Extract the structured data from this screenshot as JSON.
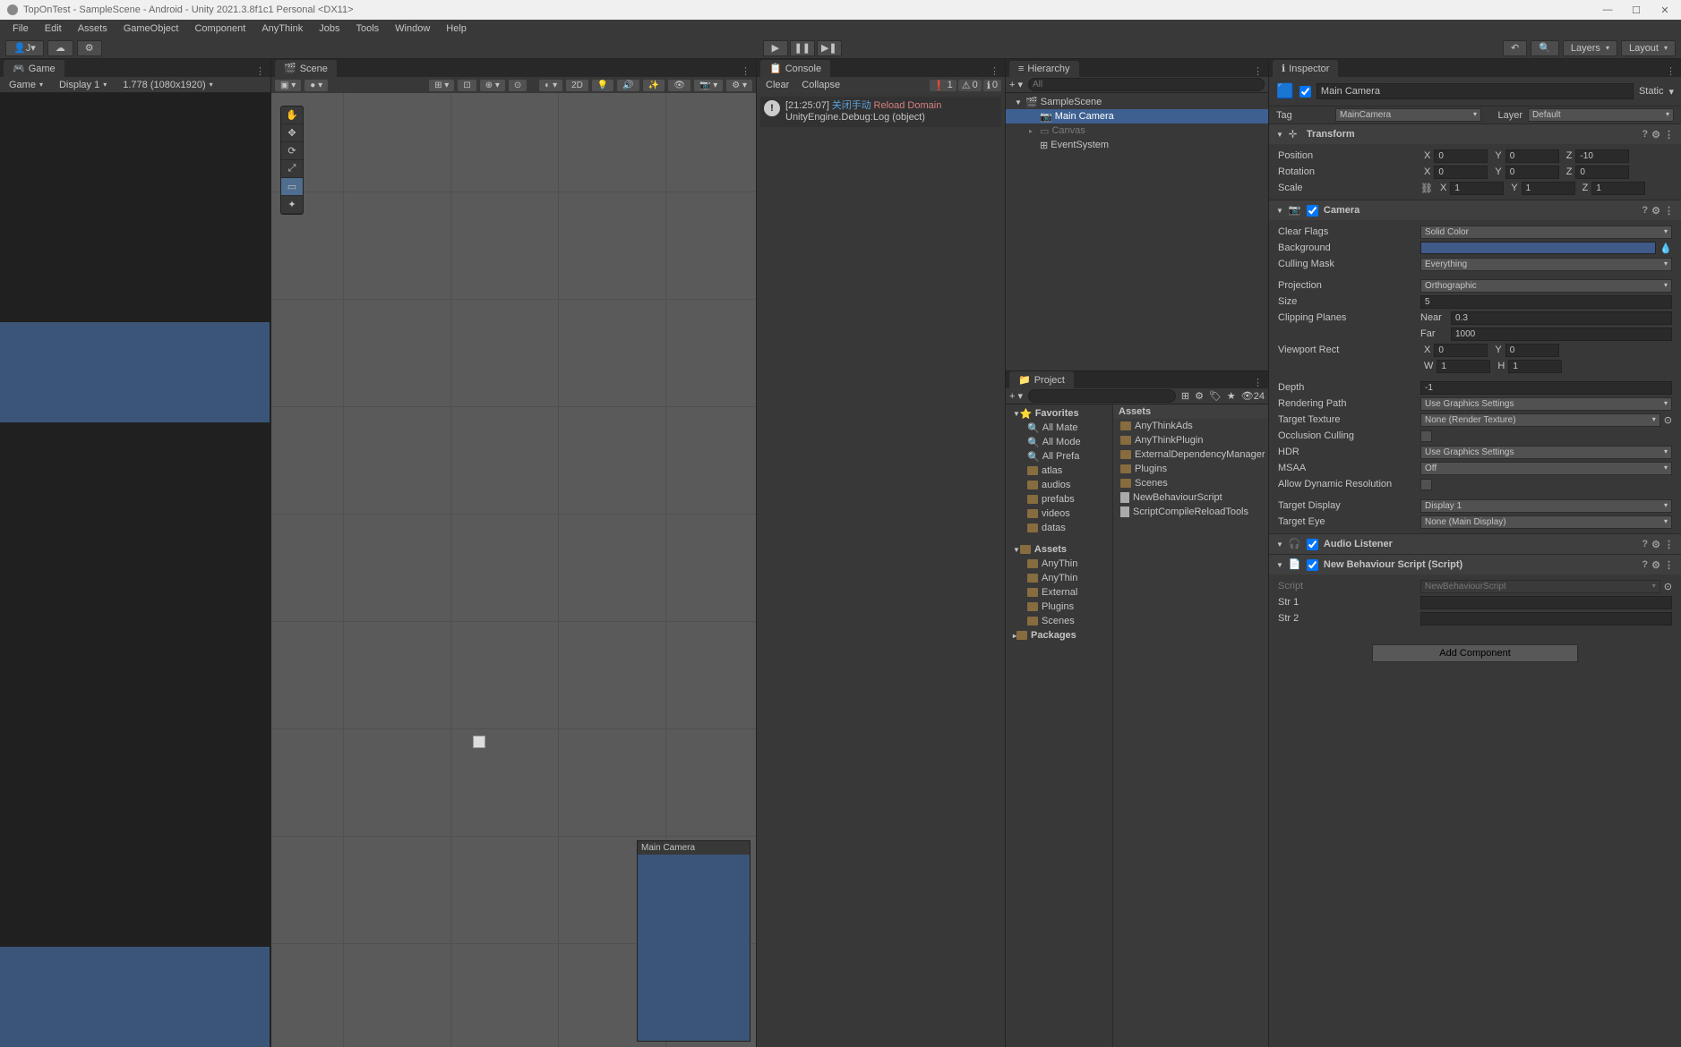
{
  "titlebar": "TopOnTest - SampleScene - Android - Unity 2021.3.8f1c1 Personal <DX11>",
  "menus": [
    "File",
    "Edit",
    "Assets",
    "GameObject",
    "Component",
    "AnyThink",
    "Jobs",
    "Tools",
    "Window",
    "Help"
  ],
  "toolbar": {
    "account": "J",
    "layers": "Layers",
    "layout": "Layout"
  },
  "game": {
    "tab": "Game",
    "mode": "Game",
    "display": "Display 1",
    "aspect": "1.778 (1080x1920)"
  },
  "scene": {
    "tab": "Scene",
    "camera_preview": "Main Camera",
    "btn2d": "2D"
  },
  "console": {
    "tab": "Console",
    "clear": "Clear",
    "collapse": "Collapse",
    "errCount": "1",
    "warnCount": "0",
    "infoCount": "0",
    "msg_time": "[21:25:07]",
    "msg_cn": "关闭手动",
    "msg_link": "Reload Domain",
    "msg_sub": "UnityEngine.Debug:Log (object)"
  },
  "hierarchy": {
    "tab": "Hierarchy",
    "search": "All",
    "items": [
      {
        "label": "SampleScene",
        "indent": 0,
        "scene": true
      },
      {
        "label": "Main Camera",
        "indent": 1,
        "selected": true
      },
      {
        "label": "Canvas",
        "indent": 1,
        "gray": true
      },
      {
        "label": "EventSystem",
        "indent": 1
      }
    ]
  },
  "project": {
    "tab": "Project",
    "hidden": "24",
    "favorites": {
      "label": "Favorites",
      "items": [
        "All Mate",
        "All Mode",
        "All Prefa"
      ]
    },
    "folders": [
      "atlas",
      "audios",
      "prefabs",
      "videos",
      "datas"
    ],
    "assets": {
      "label": "Assets",
      "items": [
        "AnyThin",
        "AnyThin",
        "External",
        "Plugins",
        "Scenes"
      ]
    },
    "packages": "Packages",
    "content_header": "Assets",
    "content": [
      {
        "label": "AnyThinkAds",
        "folder": true
      },
      {
        "label": "AnyThinkPlugin",
        "folder": true
      },
      {
        "label": "ExternalDependencyManager",
        "folder": true
      },
      {
        "label": "Plugins",
        "folder": true
      },
      {
        "label": "Scenes",
        "folder": true
      },
      {
        "label": "NewBehaviourScript",
        "folder": false
      },
      {
        "label": "ScriptCompileReloadTools",
        "folder": false
      }
    ]
  },
  "inspector": {
    "tab": "Inspector",
    "name": "Main Camera",
    "static": "Static",
    "tag_label": "Tag",
    "tag": "MainCamera",
    "layer_label": "Layer",
    "layer": "Default",
    "transform": {
      "title": "Transform",
      "pos": "Position",
      "rot": "Rotation",
      "scale": "Scale",
      "px": "0",
      "py": "0",
      "pz": "-10",
      "rx": "0",
      "ry": "0",
      "rz": "0",
      "sx": "1",
      "sy": "1",
      "sz": "1"
    },
    "camera": {
      "title": "Camera",
      "clear_flags_l": "Clear Flags",
      "clear_flags": "Solid Color",
      "background_l": "Background",
      "culling_l": "Culling Mask",
      "culling": "Everything",
      "projection_l": "Projection",
      "projection": "Orthographic",
      "size_l": "Size",
      "size": "5",
      "clip_l": "Clipping Planes",
      "near_l": "Near",
      "near": "0.3",
      "far_l": "Far",
      "far": "1000",
      "viewport_l": "Viewport Rect",
      "vx": "0",
      "vy": "0",
      "vw": "1",
      "vh": "1",
      "depth_l": "Depth",
      "depth": "-1",
      "render_l": "Rendering Path",
      "render": "Use Graphics Settings",
      "target_tex_l": "Target Texture",
      "target_tex": "None (Render Texture)",
      "occ_l": "Occlusion Culling",
      "hdr_l": "HDR",
      "hdr": "Use Graphics Settings",
      "msaa_l": "MSAA",
      "msaa": "Off",
      "dynres_l": "Allow Dynamic Resolution",
      "target_disp_l": "Target Display",
      "target_disp": "Display 1",
      "target_eye_l": "Target Eye",
      "target_eye": "None (Main Display)"
    },
    "audio": {
      "title": "Audio Listener"
    },
    "script": {
      "title": "New Behaviour Script (Script)",
      "script_l": "Script",
      "script": "NewBehaviourScript",
      "str1": "Str 1",
      "str2": "Str 2"
    },
    "add": "Add Component"
  }
}
